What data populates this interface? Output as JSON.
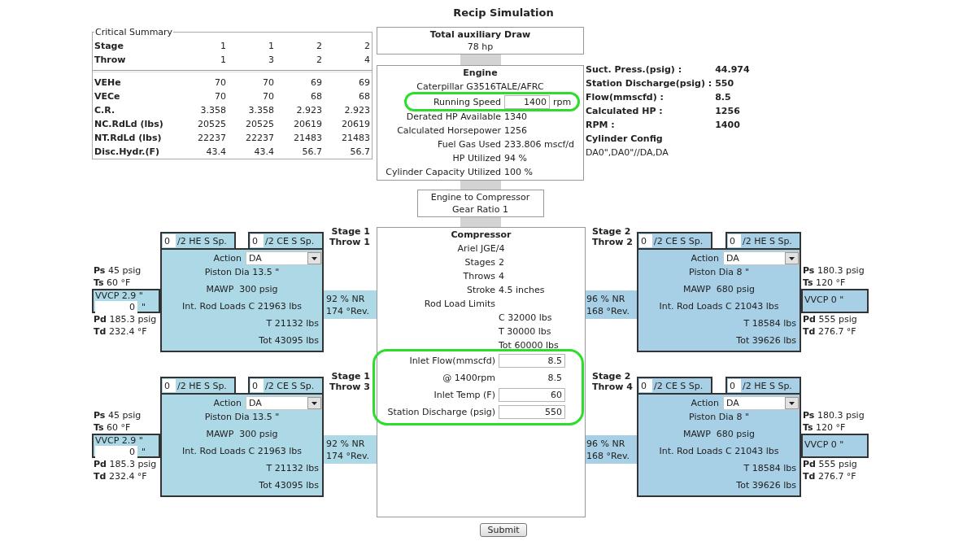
{
  "title": "Recip Simulation",
  "critical_summary": {
    "legend": "Critical Summary",
    "header_rows": [
      {
        "label": "Stage",
        "values": [
          "1",
          "1",
          "2",
          "2"
        ]
      },
      {
        "label": "Throw",
        "values": [
          "1",
          "3",
          "2",
          "4"
        ]
      }
    ],
    "rows": [
      {
        "label": "VEHe",
        "values": [
          "70",
          "70",
          "69",
          "69"
        ]
      },
      {
        "label": "VECe",
        "values": [
          "70",
          "70",
          "68",
          "68"
        ]
      },
      {
        "label": "C.R.",
        "values": [
          "3.358",
          "3.358",
          "2.923",
          "2.923"
        ]
      },
      {
        "label": "NC.RdLd (lbs)",
        "values": [
          "20525",
          "20525",
          "20619",
          "20619"
        ]
      },
      {
        "label": "NT.RdLd (lbs)",
        "values": [
          "22237",
          "22237",
          "21483",
          "21483"
        ]
      },
      {
        "label": "Disc.Hydr.(F)",
        "values": [
          "43.4",
          "43.4",
          "56.7",
          "56.7"
        ]
      }
    ]
  },
  "auxiliary": {
    "title": "Total auxiliary Draw",
    "value": "78 hp"
  },
  "engine": {
    "title": "Engine",
    "model": "Caterpillar G3516TALE/AFRC",
    "running_speed": {
      "label": "Running Speed",
      "value": "1400",
      "unit": "rpm",
      "highlighted": true
    },
    "rows": [
      {
        "label": "Derated HP Available",
        "value": "1340"
      },
      {
        "label": "Calculated Horsepower",
        "value": "1256"
      },
      {
        "label": "Fuel Gas Used",
        "value": "233.806 mscf/d"
      },
      {
        "label": "HP Utilized",
        "value": "94 %"
      },
      {
        "label": "Cylinder Capacity Utilized",
        "value": "100 %"
      }
    ]
  },
  "gear": {
    "title": "Engine to Compressor",
    "ratio": "Gear Ratio 1"
  },
  "station_summary": {
    "rows": [
      {
        "label": "Suct. Press.(psig) :",
        "value": "44.974"
      },
      {
        "label": "Station Discharge(psig) :",
        "value": "550"
      },
      {
        "label": "Flow(mmscfd) :",
        "value": "8.5"
      },
      {
        "label": "Calculated HP :",
        "value": "1256"
      },
      {
        "label": "RPM :",
        "value": "1400"
      }
    ],
    "config_label": "Cylinder Config",
    "config_value": "DA0\",DA0\"//DA,DA"
  },
  "compressor": {
    "title": "Compressor",
    "model": "Ariel JGE/4",
    "rows": [
      {
        "label": "Stages",
        "value": "2"
      },
      {
        "label": "Throws",
        "value": "4"
      },
      {
        "label": "Stroke",
        "value": "4.5 inches"
      },
      {
        "label": "Rod Load Limits"
      },
      {
        "value": "C 32000 lbs"
      },
      {
        "value": "T 30000 lbs"
      },
      {
        "value": "Tot 60000 lbs"
      }
    ],
    "inputs": {
      "highlighted": true,
      "rows": [
        {
          "kind": "input",
          "label": "Inlet Flow(mmscfd)",
          "value": "8.5"
        },
        {
          "kind": "text",
          "label": "@ 1400rpm",
          "value": "8.5"
        },
        {
          "kind": "input",
          "label": "Inlet Temp (F)",
          "value": "60"
        },
        {
          "kind": "input",
          "label": "Station Discharge (psig)",
          "value": "550"
        }
      ]
    }
  },
  "cylinders_left": [
    {
      "stage": "Stage 1",
      "throw": "Throw 1",
      "spares": [
        {
          "value": "0",
          "label": "/2 HE S Sp."
        },
        {
          "value": "0",
          "label": "/2 CE S Sp."
        }
      ],
      "action": {
        "label": "Action",
        "value": "DA"
      },
      "specs": [
        "Piston Dia 13.5 \"",
        "MAWP  300 psig",
        "Int. Rod Loads C 21963 lbs"
      ],
      "loads": [
        "T 21132 lbs",
        "Tot 43095 lbs"
      ],
      "suction": [
        {
          "label": "Ps",
          "value": "45 psig"
        },
        {
          "label": "Ts",
          "value": "60 °F"
        }
      ],
      "vvcp": {
        "label": "VVCP 2.9 \"",
        "value": "0",
        "unit": "\""
      },
      "discharge": [
        {
          "label": "Pd",
          "value": "185.3 psig"
        },
        {
          "label": "Td",
          "value": "232.4 °F"
        }
      ],
      "nr": [
        "92 % NR",
        "174 °Rev."
      ]
    },
    {
      "stage": "Stage 1",
      "throw": "Throw 3",
      "spares": [
        {
          "value": "0",
          "label": "/2 HE S Sp."
        },
        {
          "value": "0",
          "label": "/2 CE S Sp."
        }
      ],
      "action": {
        "label": "Action",
        "value": "DA"
      },
      "specs": [
        "Piston Dia 13.5 \"",
        "MAWP  300 psig",
        "Int. Rod Loads C 21963 lbs"
      ],
      "loads": [
        "T 21132 lbs",
        "Tot 43095 lbs"
      ],
      "suction": [
        {
          "label": "Ps",
          "value": "45 psig"
        },
        {
          "label": "Ts",
          "value": "60 °F"
        }
      ],
      "vvcp": {
        "label": "VVCP 2.9 \"",
        "value": "0",
        "unit": "\""
      },
      "discharge": [
        {
          "label": "Pd",
          "value": "185.3 psig"
        },
        {
          "label": "Td",
          "value": "232.4 °F"
        }
      ],
      "nr": [
        "92 % NR",
        "174 °Rev."
      ]
    }
  ],
  "cylinders_right": [
    {
      "stage": "Stage 2",
      "throw": "Throw 2",
      "spares": [
        {
          "value": "0",
          "label": "/2 CE S Sp."
        },
        {
          "value": "0",
          "label": "/2 HE S Sp."
        }
      ],
      "action": {
        "label": "Action",
        "value": "DA"
      },
      "specs": [
        "Piston Dia 8 \"",
        "MAWP  680 psig",
        "Int. Rod Loads C 21043 lbs"
      ],
      "loads": [
        "T 18584 lbs",
        "Tot 39626 lbs"
      ],
      "suction": [
        {
          "label": "Ps",
          "value": "180.3 psig"
        },
        {
          "label": "Ts",
          "value": "120 °F"
        }
      ],
      "vvcp": {
        "label": "VVCP 0 \""
      },
      "discharge": [
        {
          "label": "Pd",
          "value": "555 psig"
        },
        {
          "label": "Td",
          "value": "276.7 °F"
        }
      ],
      "nr": [
        "96 % NR",
        "168 °Rev."
      ]
    },
    {
      "stage": "Stage 2",
      "throw": "Throw 4",
      "spares": [
        {
          "value": "0",
          "label": "/2 CE S Sp."
        },
        {
          "value": "0",
          "label": "/2 HE S Sp."
        }
      ],
      "action": {
        "label": "Action",
        "value": "DA"
      },
      "specs": [
        "Piston Dia 8 \"",
        "MAWP  680 psig",
        "Int. Rod Loads C 21043 lbs"
      ],
      "loads": [
        "T 18584 lbs",
        "Tot 39626 lbs"
      ],
      "suction": [
        {
          "label": "Ps",
          "value": "180.3 psig"
        },
        {
          "label": "Ts",
          "value": "120 °F"
        }
      ],
      "vvcp": {
        "label": "VVCP 0 \""
      },
      "discharge": [
        {
          "label": "Pd",
          "value": "555 psig"
        },
        {
          "label": "Td",
          "value": "276.7 °F"
        }
      ],
      "nr": [
        "96 % NR",
        "168 °Rev."
      ]
    }
  ],
  "submit": "Submit"
}
